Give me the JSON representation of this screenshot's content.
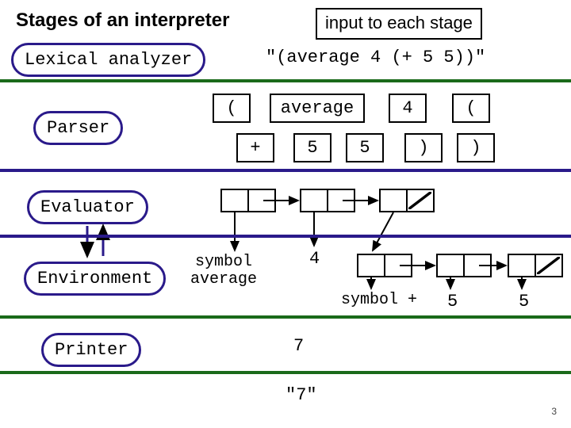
{
  "title": "Stages of an interpreter",
  "input_label": "input to each stage",
  "stages": {
    "lexical": "Lexical analyzer",
    "parser": "Parser",
    "evaluator": "Evaluator",
    "environment": "Environment",
    "printer": "Printer"
  },
  "lexical_input": "\"(average 4 (+ 5 5))\"",
  "tokens": {
    "t0": "(",
    "t1": "average",
    "t2": "4",
    "t3": "(",
    "t4": "+",
    "t5": "5",
    "t6": "5",
    "t7": ")",
    "t8": ")"
  },
  "parse": {
    "sym_average_l1": "symbol",
    "sym_average_l2": "average",
    "four": "4",
    "sym_plus": "symbol +",
    "five_a": "5",
    "five_b": "5"
  },
  "eval_result": "7",
  "print_result": "\"7\"",
  "page_number": "3"
}
